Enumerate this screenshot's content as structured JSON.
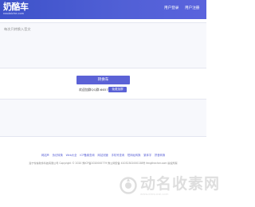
{
  "header": {
    "logo_text": "奶酪车",
    "logo_subtext": "naolaiche.com",
    "nav_login": "用户登录",
    "nav_register": "用户注册"
  },
  "input": {
    "placeholder": "每次只转换入音文"
  },
  "output": {
    "placeholder": ""
  },
  "actions": {
    "convert_label": "转换车",
    "qq_text": "欢迎加群QQ群:66575 3962",
    "qq_button_label": "免费加群"
  },
  "footer": {
    "links": [
      "网站声",
      "伪记转换",
      "Web大全",
      "ICP备案查询",
      "网站测速",
      "手机号查询",
      "短网址转换",
      "繁体字",
      "拼音转换"
    ],
    "copyright": "洛宁零信软件科技有限公司  Copyright © 2020  豫ICP备2020000779  豫公网安备 41032302000138号  fengthecher.com  版权所有"
  },
  "watermark": {
    "text": "动名收素网",
    "subtext": "www.dmsucai.com",
    "color": "#d9d9d9"
  },
  "colors": {
    "header_gradient_start": "#3d52c9",
    "header_gradient_end": "#5a63dd",
    "accent": "#5b62d6",
    "panel_background": "#f7f8fc"
  }
}
